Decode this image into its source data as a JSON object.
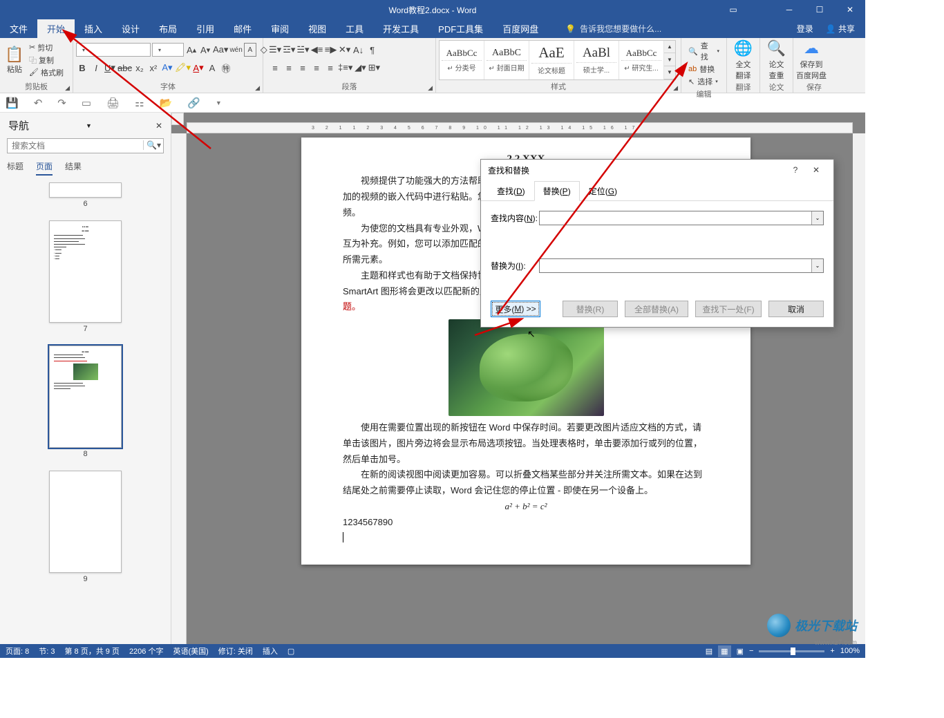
{
  "titlebar": {
    "title": "Word教程2.docx - Word"
  },
  "menubar": {
    "tabs": [
      "文件",
      "开始",
      "插入",
      "设计",
      "布局",
      "引用",
      "邮件",
      "审阅",
      "视图",
      "工具",
      "开发工具",
      "PDF工具集",
      "百度网盘"
    ],
    "active_tab": "开始",
    "tellme": "告诉我您想要做什么...",
    "login": "登录",
    "share": "共享"
  },
  "ribbon": {
    "clipboard": {
      "paste": "粘贴",
      "cut": "剪切",
      "copy": "复制",
      "painter": "格式刷",
      "label": "剪贴板"
    },
    "font": {
      "name_placeholder": " ",
      "size_placeholder": " ",
      "label": "字体"
    },
    "paragraph": {
      "label": "段落"
    },
    "styles": {
      "label": "样式",
      "items": [
        {
          "preview": "AaBbCc",
          "name": "↵ 分类号"
        },
        {
          "preview": "AaBbC",
          "name": "↵ 封面日期"
        },
        {
          "preview": "AaE",
          "name": "论文标题"
        },
        {
          "preview": "AaBl",
          "name": "硕士学..."
        },
        {
          "preview": "AaBbCc",
          "name": "↵ 研究生..."
        }
      ]
    },
    "editing": {
      "find": "查找",
      "replace": "替换",
      "select": "选择",
      "label": "编辑"
    },
    "translate": {
      "top": "全文",
      "bottom": "翻译",
      "label": "翻译"
    },
    "lookup": {
      "top": "论文",
      "bottom": "查重",
      "label": "论文"
    },
    "save": {
      "top": "保存到",
      "bottom": "百度网盘",
      "label": "保存"
    }
  },
  "navigation": {
    "title": "导航",
    "search_placeholder": "搜索文档",
    "tabs": [
      "标题",
      "页面",
      "结果"
    ],
    "active_tab": "页面",
    "thumbs": [
      6,
      7,
      8,
      9
    ],
    "selected": 8
  },
  "document": {
    "heading": "2.2 XXX",
    "para1": "视频提供了功能强大的方法帮助您证明您的观点。当您单击联机视频时，可以在想要添加的视频的嵌入代码中进行粘贴。您也可以键入一个关键字以联机搜索最适合您的文档的视频。",
    "para2a": "为使您的文档具有专业外观，Word 提供了页眉、页脚、封面和文本框设计，这些设计可互为补充。例如，您可以添加匹配的封面、页眉和提要栏。单击\"插入\"，然后从不同库中选择所需元素。",
    "para2b": "主题和样式也有助于文档保持协调。当您单击设计并选择新的主题时，图片、图表或 SmartArt 图形将会更改以匹配新的主题。当应用样式时，您的标题会进",
    "para2c": "行更改以匹配新的主题。",
    "para3": "使用在需要位置出现的新按钮在 Word 中保存时间。若要更改图片适应文档的方式，请单击该图片，图片旁边将会显示布局选项按钮。当处理表格时，单击要添加行或列的位置，然后单击加号。",
    "para4": "在新的阅读视图中阅读更加容易。可以折叠文档某些部分并关注所需文本。如果在达到结尾处之前需要停止读取，Word 会记住您的停止位置 - 即使在另一个设备上。",
    "formula": "a² + b² = c²",
    "numbers": "1234567890"
  },
  "ruler": "3 2 1   1 2 3 4 5 6 7 8 9 10 11 12 13 14 15 16 17",
  "dialog": {
    "title": "查找和替换",
    "tabs": {
      "find": "查找(D)",
      "replace": "替换(P)",
      "goto": "定位(G)"
    },
    "find_label": "查找内容(N):",
    "replace_label": "替换为(I):",
    "more": "更多(M) >>",
    "btn_replace": "替换(R)",
    "btn_replace_all": "全部替换(A)",
    "btn_find_next": "查找下一处(F)",
    "btn_cancel": "取消"
  },
  "statusbar": {
    "page": "页面: 8",
    "section": "节: 3",
    "pages": "第 8 页，共 9 页",
    "words": "2206 个字",
    "lang": "英语(美国)",
    "track": "修订: 关闭",
    "mode": "插入",
    "zoom": "100%"
  },
  "watermark": {
    "text": "极光下载站",
    "url": "www.xz7.com"
  }
}
